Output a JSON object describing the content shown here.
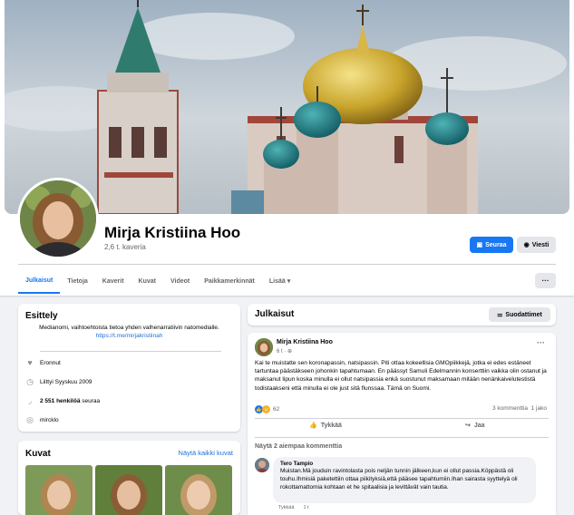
{
  "profile": {
    "name": "Mirja Kristiina Hoo",
    "friends": "2,6 t. kaveria",
    "follow_label": "Seuraa",
    "message_label": "Viesti"
  },
  "tabs": [
    "Julkaisut",
    "Tietoja",
    "Kaverit",
    "Kuvat",
    "Videot",
    "Paikkamerkinnät",
    "Lisää"
  ],
  "more_menu": "···",
  "intro": {
    "title": "Esittely",
    "bio": "Medianomi, vaihtoehtoista tietoa yhden valhenarratiivin natomedialle.",
    "bio_link": "https://t.me/mirjakristiinah",
    "relationship": "Eronnut",
    "joined": "Liittyi Syyskuu 2009",
    "followers_count": "2 551 henkilöä",
    "followers_suffix": "seuraa",
    "website": "mircklo"
  },
  "photos": {
    "title": "Kuvat",
    "see_all": "Näytä kaikki kuvat"
  },
  "posts_header": {
    "title": "Julkaisut",
    "filter_label": "Suodattimet"
  },
  "post": {
    "author": "Mirja Kristiina Hoo",
    "time": "6 t ·",
    "text": "Kai te muistatte sen koronapassin, natsipassin. Piti ottaa kokeellisia GMOpiikkejä, jotka ei edes estäneet tartuntaa päästäkseen johonkin tapahtumaan. En päässyt Samuli Edelmannin konserttiin vaikka olin ostanut ja maksanut lipun koska minulla ei ollut natsipassia enkä suostunut maksamaan mitään nenänkaivelutestistä todistaakseni että minulla ei ole just sitä flunssaa. Tämä on Suomi.",
    "reaction_count": "62",
    "comments_count": "3 kommenttia",
    "shares_count": "1 jako",
    "like_label": "Tykkää",
    "share_label": "Jaa",
    "previous_comments": "Näytä 2 aiempaa kommenttia"
  },
  "comment": {
    "author": "Tero Tampio",
    "text": "Muistan.Mä jouduin ravintolasta pois neljän tunnin jälkeen,kun ei ollut passia.Köppästä oli touhu.Ihmisiä paketettiin ottaa piikityksiä,että pääsee tapahtumiin.Ihan sairasta syyttelyä oli rokottamattomia kohtaan et he spitaalisia ja levittävät vain tautia.",
    "like_label": "Tykkää",
    "time": "1 t"
  },
  "colors": {
    "accent": "#1877f2",
    "link": "#216fdb",
    "background": "#f0f2f5"
  }
}
